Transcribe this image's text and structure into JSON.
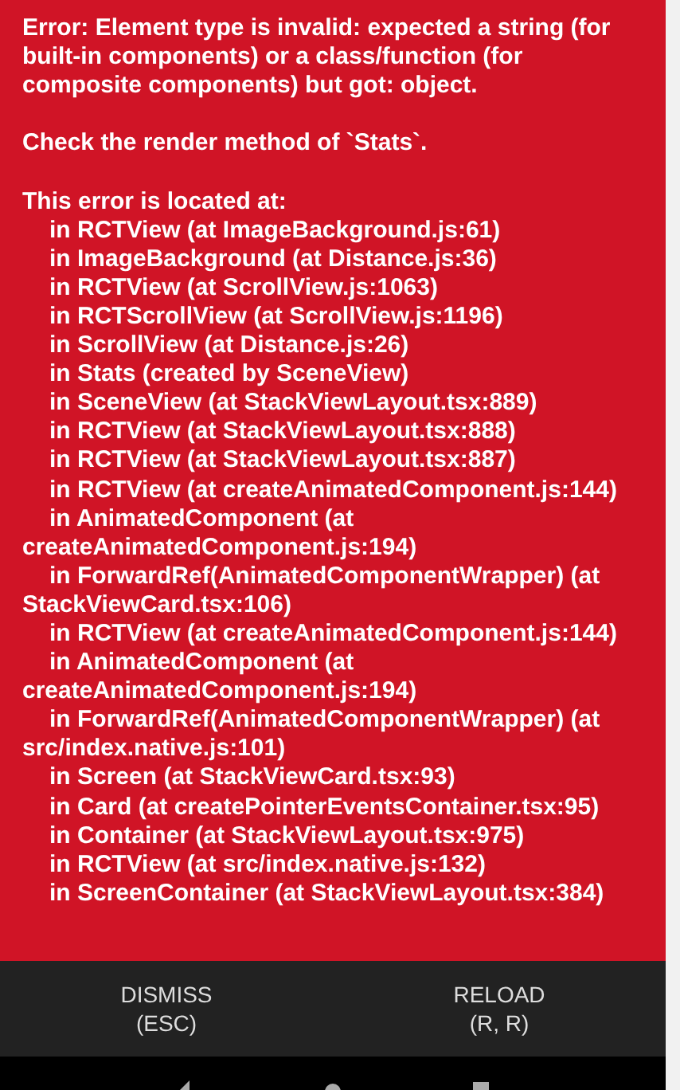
{
  "error": {
    "message": "Error: Element type is invalid: expected a string (for built-in components) or a class/function (for composite components) but got: object.",
    "hint": "Check the render method of `Stats`.",
    "location_heading": "This error is located at:",
    "frames": [
      "in RCTView (at ImageBackground.js:61)",
      "in ImageBackground (at Distance.js:36)",
      "in RCTView (at ScrollView.js:1063)",
      "in RCTScrollView (at ScrollView.js:1196)",
      "in ScrollView (at Distance.js:26)",
      "in Stats (created by SceneView)",
      "in SceneView (at StackViewLayout.tsx:889)",
      "in RCTView (at StackViewLayout.tsx:888)",
      "in RCTView (at StackViewLayout.tsx:887)",
      "in RCTView (at createAnimatedComponent.js:144)",
      "in AnimatedComponent (at createAnimatedComponent.js:194)",
      "in ForwardRef(AnimatedComponentWrapper) (at StackViewCard.tsx:106)",
      "in RCTView (at createAnimatedComponent.js:144)",
      "in AnimatedComponent (at createAnimatedComponent.js:194)",
      "in ForwardRef(AnimatedComponentWrapper) (at src/index.native.js:101)",
      "in Screen (at StackViewCard.tsx:93)",
      "in Card (at createPointerEventsContainer.tsx:95)",
      "in Container (at StackViewLayout.tsx:975)",
      "in RCTView (at src/index.native.js:132)",
      "in ScreenContainer (at StackViewLayout.tsx:384)"
    ]
  },
  "buttons": [
    {
      "label": "DISMISS",
      "shortcut": "(ESC)"
    },
    {
      "label": "RELOAD",
      "shortcut": "(R, R)"
    }
  ]
}
